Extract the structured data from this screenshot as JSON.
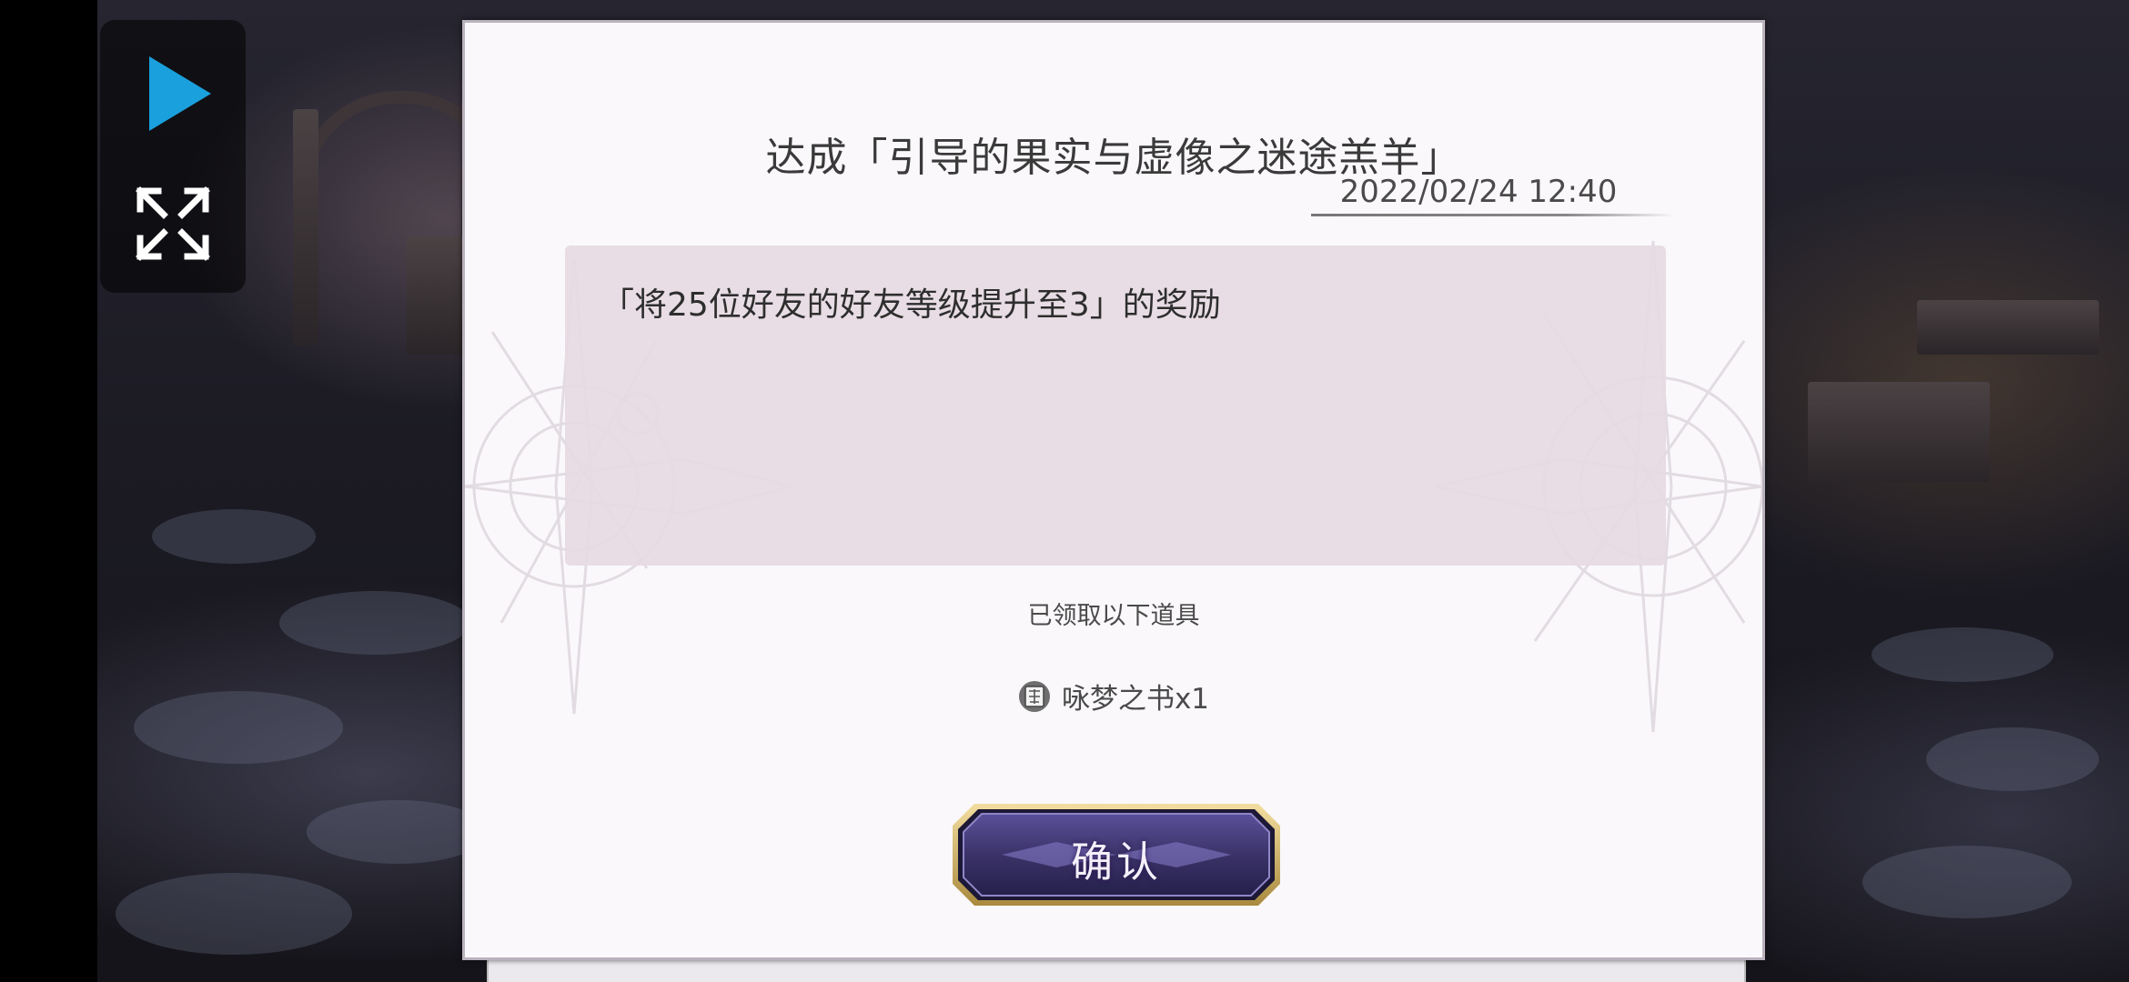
{
  "player_controls": {
    "play_icon": "play-icon",
    "fullscreen_icon": "fullscreen-icon",
    "accent_color": "#1aa0dc"
  },
  "dialog": {
    "title": "达成「引导的果实与虚像之迷途羔羊」",
    "date": "2022/02/24 12:40",
    "message": "「将25位好友的好友等级提升至3」的奖励",
    "received_label": "已领取以下道具",
    "reward": {
      "icon": "book-icon",
      "text": "咏梦之书x1"
    },
    "confirm_label": "确认"
  },
  "colors": {
    "dialog_background": "#faf8fb",
    "message_box": "#e6dae2",
    "button_fill": "#3b3368",
    "button_border": "#d9b96a"
  }
}
